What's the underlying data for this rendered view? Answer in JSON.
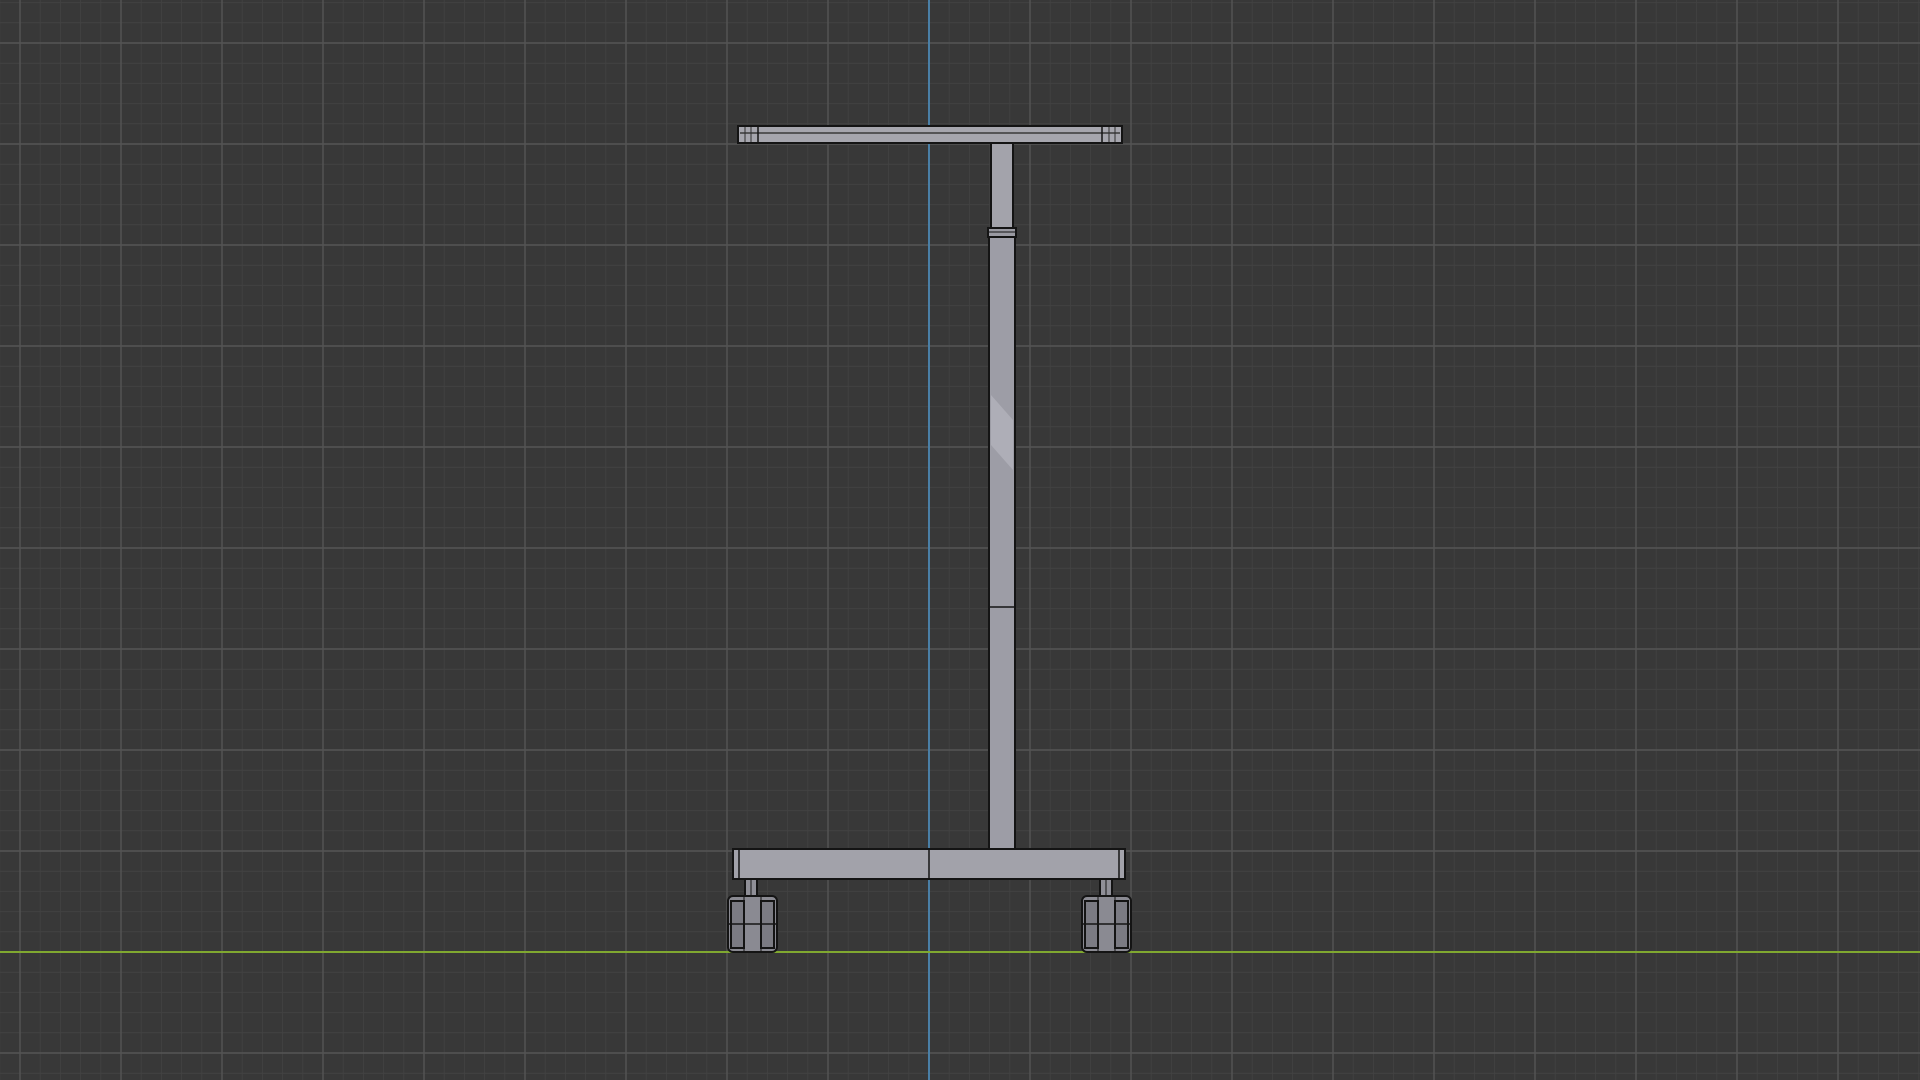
{
  "viewport": {
    "view": "front-orthographic",
    "object": "overbed-table-model",
    "colors": {
      "background": "#383838",
      "grid_minor": "#424242",
      "grid_major": "#555555",
      "axis_x": "#80a830",
      "axis_z": "#4a7fa6",
      "model_fill": "#9d9da6",
      "model_fill_light": "#aeaeb7",
      "model_outline": "#141414"
    }
  }
}
